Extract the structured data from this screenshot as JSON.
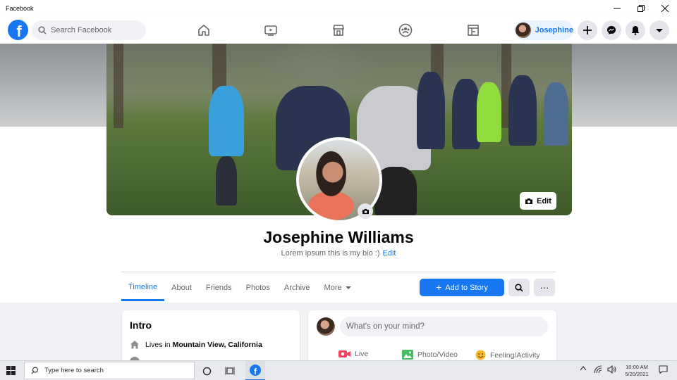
{
  "window": {
    "title": "Facebook"
  },
  "nav": {
    "logo_letter": "f",
    "search_placeholder": "Search Facebook",
    "profile_name": "Josephine"
  },
  "cover": {
    "edit_label": "Edit"
  },
  "profile": {
    "name": "Josephine Williams",
    "bio": "Lorem ipsum this is my bio :)",
    "bio_edit": "Edit"
  },
  "tabs": [
    {
      "label": "Timeline"
    },
    {
      "label": "About"
    },
    {
      "label": "Friends"
    },
    {
      "label": "Photos"
    },
    {
      "label": "Archive"
    },
    {
      "label": "More"
    }
  ],
  "actions": {
    "add_story": "Add to Story",
    "more_dots": "···"
  },
  "intro": {
    "title": "Intro",
    "lives_in_key": "Lives in",
    "lives_in_value": "Mountain View, California"
  },
  "composer": {
    "placeholder": "What's on your mind?",
    "live": "Live",
    "photo_video": "Photo/Video",
    "feeling": "Feeling/Activity"
  },
  "taskbar": {
    "search_placeholder": "Type here to search",
    "fb_letter": "f",
    "time": "10:00 AM",
    "date": "5/20/2021"
  },
  "colors": {
    "brand": "#1877f2",
    "live": "#f3425f",
    "photo": "#45bd62",
    "feeling": "#f7b928"
  }
}
